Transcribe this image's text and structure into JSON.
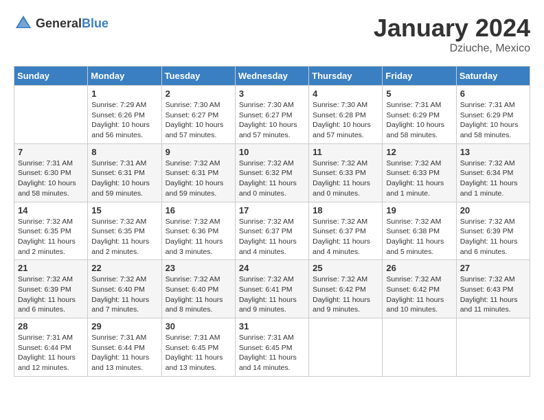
{
  "header": {
    "logo_general": "General",
    "logo_blue": "Blue",
    "title": "January 2024",
    "subtitle": "Dziuche, Mexico"
  },
  "calendar": {
    "days_of_week": [
      "Sunday",
      "Monday",
      "Tuesday",
      "Wednesday",
      "Thursday",
      "Friday",
      "Saturday"
    ],
    "weeks": [
      [
        {
          "day": "",
          "info": ""
        },
        {
          "day": "1",
          "info": "Sunrise: 7:29 AM\nSunset: 6:26 PM\nDaylight: 10 hours\nand 56 minutes."
        },
        {
          "day": "2",
          "info": "Sunrise: 7:30 AM\nSunset: 6:27 PM\nDaylight: 10 hours\nand 57 minutes."
        },
        {
          "day": "3",
          "info": "Sunrise: 7:30 AM\nSunset: 6:27 PM\nDaylight: 10 hours\nand 57 minutes."
        },
        {
          "day": "4",
          "info": "Sunrise: 7:30 AM\nSunset: 6:28 PM\nDaylight: 10 hours\nand 57 minutes."
        },
        {
          "day": "5",
          "info": "Sunrise: 7:31 AM\nSunset: 6:29 PM\nDaylight: 10 hours\nand 58 minutes."
        },
        {
          "day": "6",
          "info": "Sunrise: 7:31 AM\nSunset: 6:29 PM\nDaylight: 10 hours\nand 58 minutes."
        }
      ],
      [
        {
          "day": "7",
          "info": "Sunrise: 7:31 AM\nSunset: 6:30 PM\nDaylight: 10 hours\nand 58 minutes."
        },
        {
          "day": "8",
          "info": "Sunrise: 7:31 AM\nSunset: 6:31 PM\nDaylight: 10 hours\nand 59 minutes."
        },
        {
          "day": "9",
          "info": "Sunrise: 7:32 AM\nSunset: 6:31 PM\nDaylight: 10 hours\nand 59 minutes."
        },
        {
          "day": "10",
          "info": "Sunrise: 7:32 AM\nSunset: 6:32 PM\nDaylight: 11 hours\nand 0 minutes."
        },
        {
          "day": "11",
          "info": "Sunrise: 7:32 AM\nSunset: 6:33 PM\nDaylight: 11 hours\nand 0 minutes."
        },
        {
          "day": "12",
          "info": "Sunrise: 7:32 AM\nSunset: 6:33 PM\nDaylight: 11 hours\nand 1 minute."
        },
        {
          "day": "13",
          "info": "Sunrise: 7:32 AM\nSunset: 6:34 PM\nDaylight: 11 hours\nand 1 minute."
        }
      ],
      [
        {
          "day": "14",
          "info": "Sunrise: 7:32 AM\nSunset: 6:35 PM\nDaylight: 11 hours\nand 2 minutes."
        },
        {
          "day": "15",
          "info": "Sunrise: 7:32 AM\nSunset: 6:35 PM\nDaylight: 11 hours\nand 2 minutes."
        },
        {
          "day": "16",
          "info": "Sunrise: 7:32 AM\nSunset: 6:36 PM\nDaylight: 11 hours\nand 3 minutes."
        },
        {
          "day": "17",
          "info": "Sunrise: 7:32 AM\nSunset: 6:37 PM\nDaylight: 11 hours\nand 4 minutes."
        },
        {
          "day": "18",
          "info": "Sunrise: 7:32 AM\nSunset: 6:37 PM\nDaylight: 11 hours\nand 4 minutes."
        },
        {
          "day": "19",
          "info": "Sunrise: 7:32 AM\nSunset: 6:38 PM\nDaylight: 11 hours\nand 5 minutes."
        },
        {
          "day": "20",
          "info": "Sunrise: 7:32 AM\nSunset: 6:39 PM\nDaylight: 11 hours\nand 6 minutes."
        }
      ],
      [
        {
          "day": "21",
          "info": "Sunrise: 7:32 AM\nSunset: 6:39 PM\nDaylight: 11 hours\nand 6 minutes."
        },
        {
          "day": "22",
          "info": "Sunrise: 7:32 AM\nSunset: 6:40 PM\nDaylight: 11 hours\nand 7 minutes."
        },
        {
          "day": "23",
          "info": "Sunrise: 7:32 AM\nSunset: 6:40 PM\nDaylight: 11 hours\nand 8 minutes."
        },
        {
          "day": "24",
          "info": "Sunrise: 7:32 AM\nSunset: 6:41 PM\nDaylight: 11 hours\nand 9 minutes."
        },
        {
          "day": "25",
          "info": "Sunrise: 7:32 AM\nSunset: 6:42 PM\nDaylight: 11 hours\nand 9 minutes."
        },
        {
          "day": "26",
          "info": "Sunrise: 7:32 AM\nSunset: 6:42 PM\nDaylight: 11 hours\nand 10 minutes."
        },
        {
          "day": "27",
          "info": "Sunrise: 7:32 AM\nSunset: 6:43 PM\nDaylight: 11 hours\nand 11 minutes."
        }
      ],
      [
        {
          "day": "28",
          "info": "Sunrise: 7:31 AM\nSunset: 6:44 PM\nDaylight: 11 hours\nand 12 minutes."
        },
        {
          "day": "29",
          "info": "Sunrise: 7:31 AM\nSunset: 6:44 PM\nDaylight: 11 hours\nand 13 minutes."
        },
        {
          "day": "30",
          "info": "Sunrise: 7:31 AM\nSunset: 6:45 PM\nDaylight: 11 hours\nand 13 minutes."
        },
        {
          "day": "31",
          "info": "Sunrise: 7:31 AM\nSunset: 6:45 PM\nDaylight: 11 hours\nand 14 minutes."
        },
        {
          "day": "",
          "info": ""
        },
        {
          "day": "",
          "info": ""
        },
        {
          "day": "",
          "info": ""
        }
      ]
    ]
  }
}
